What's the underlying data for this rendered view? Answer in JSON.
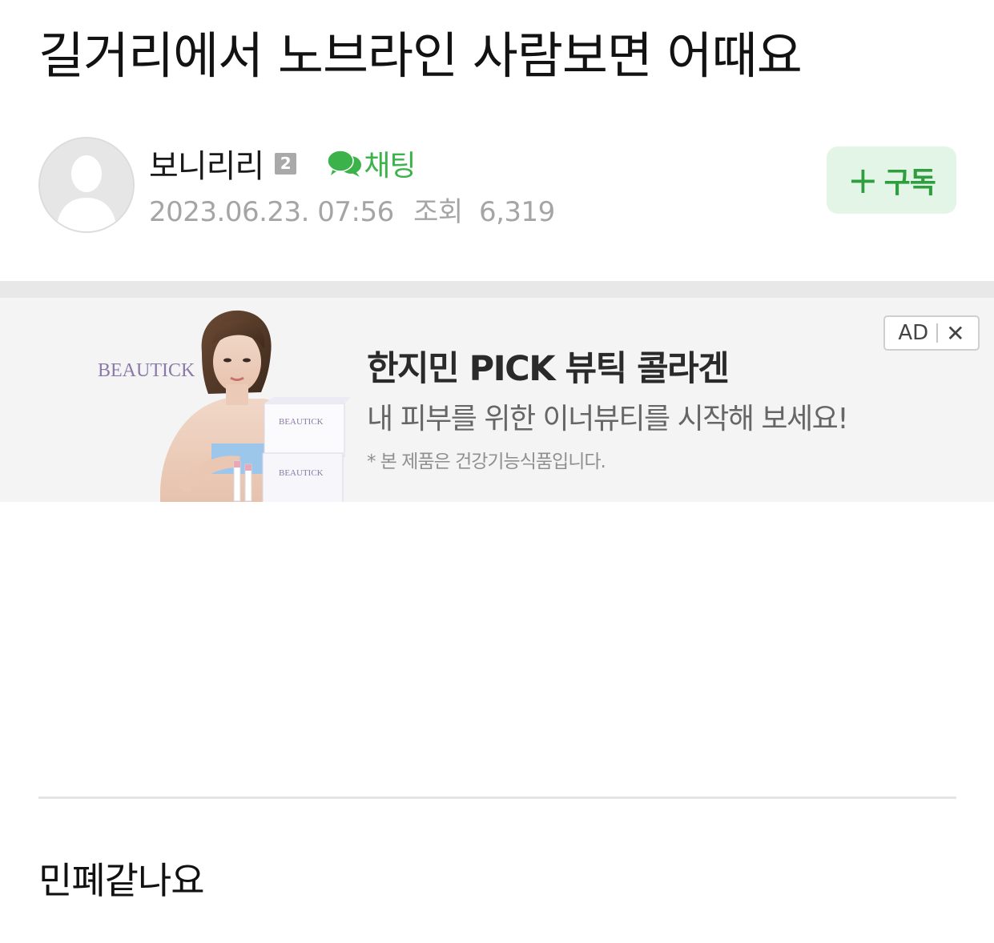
{
  "post": {
    "title": "길거리에서 노브라인 사람보면 어때요",
    "body": "민폐같나요"
  },
  "author": {
    "name": "보니리리",
    "level": "2",
    "chat_label": "채팅",
    "date": "2023.06.23. 07:56",
    "views_label": "조회",
    "views": "6,319",
    "avatar_icon": "default-user-avatar",
    "chat_icon": "speech-bubbles-icon"
  },
  "subscribe": {
    "plus": "+",
    "label": "구독"
  },
  "ad": {
    "brand": "BEAUTICK",
    "headline": "한지민 PICK 뷰틱 콜라겐",
    "subheadline": "내 피부를 위한 이너뷰티를 시작해 보세요!",
    "note": "* 본 제품은 건강기능식품입니다.",
    "badge_label": "AD",
    "close_symbol": "✕",
    "box_brand": "BEAUTICK"
  },
  "colors": {
    "accent_green": "#3cb34a",
    "subscribe_bg": "#e3f5e6",
    "meta_gray": "#a5a5a5",
    "ad_bg": "#f4f4f5"
  }
}
